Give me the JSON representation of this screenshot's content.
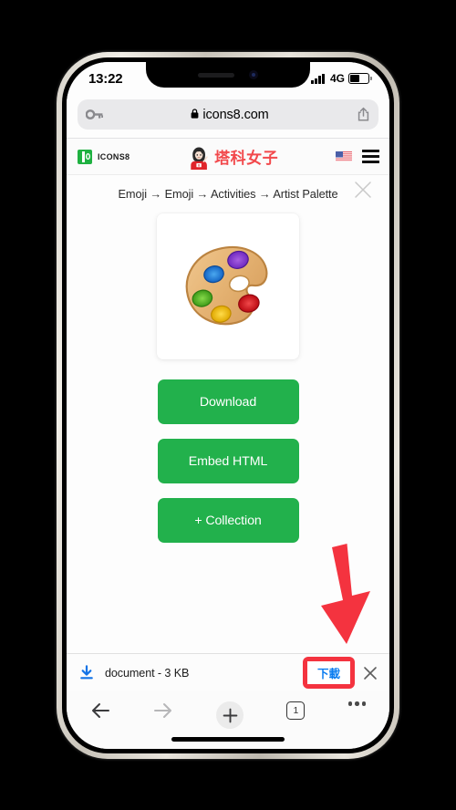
{
  "status_bar": {
    "time": "13:22",
    "network_type": "4G",
    "signal_icon": "signal-bars-icon",
    "battery_icon": "battery-icon",
    "battery_level_percent": 55
  },
  "browser": {
    "url": "icons8.com",
    "lock_icon": "lock-icon",
    "key_icon": "key-icon",
    "share_icon": "share-icon"
  },
  "site_header": {
    "icons8_wordmark": "ICONS8",
    "icons8_logo_icon": "icons8-logo-icon",
    "site_name": "塔科女子",
    "site_avatar_icon": "site-avatar-icon",
    "lang_flag_icon": "us-flag-icon",
    "menu_icon": "hamburger-menu-icon"
  },
  "breadcrumb": {
    "text": "Emoji → Emoji → Activities → Artist Palette",
    "items": [
      "Emoji",
      "Emoji",
      "Activities",
      "Artist Palette"
    ],
    "separator": "→",
    "close_icon": "close-icon"
  },
  "content": {
    "preview_icon": "artist-palette-emoji",
    "buttons": [
      {
        "label": "Download",
        "name": "download-button"
      },
      {
        "label": "Embed HTML",
        "name": "embed-html-button"
      },
      {
        "label": "+ Collection",
        "name": "add-collection-button"
      }
    ]
  },
  "download_bar": {
    "download_icon": "download-arrow-icon",
    "file_label": "document - 3 KB",
    "confirm_label": "下載",
    "close_icon": "close-icon",
    "highlight_color": "#f4333f",
    "confirm_text_color": "#0a7cf0"
  },
  "toolbar": {
    "back_icon": "back-arrow-icon",
    "forward_icon": "forward-arrow-icon",
    "add_icon": "plus-icon",
    "tab_count": "1",
    "more_icon": "more-dots-icon"
  },
  "annotation": {
    "arrow_icon": "red-down-arrow-annotation",
    "arrow_color": "#f4333f"
  },
  "theme": {
    "button_green": "#22b14c",
    "brand_red": "#f2494c",
    "link_blue": "#0a7cf0",
    "icons8_green": "#1fb141"
  }
}
